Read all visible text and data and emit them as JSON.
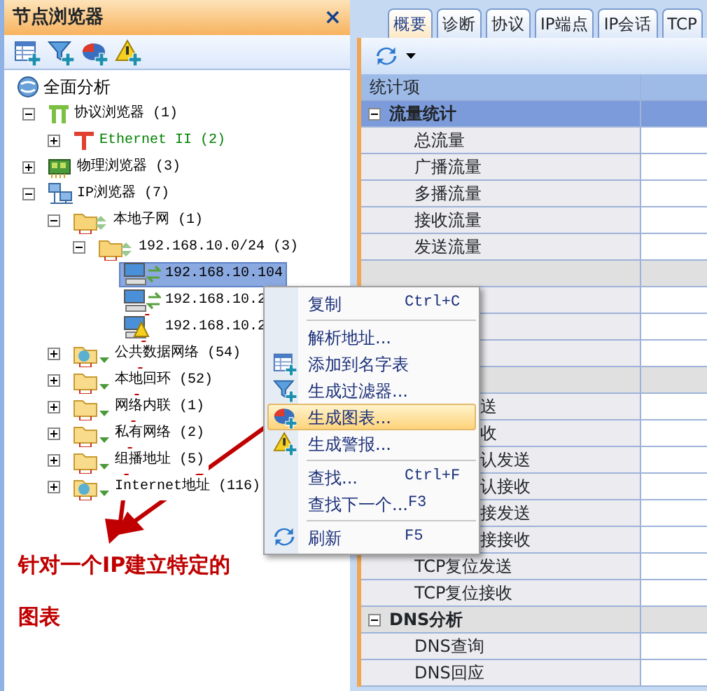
{
  "left_panel": {
    "title": "节点浏览器",
    "close": "×",
    "tree": [
      {
        "label": "全面分析",
        "kind": "analysis",
        "color": "#000000",
        "selected": false,
        "children": [
          {
            "label": "协议浏览器 (1)",
            "kind": "protocol",
            "color": "#000000",
            "selected": false,
            "expanded": true,
            "children": [
              {
                "label": "Ethernet II (2)",
                "kind": "ethernet",
                "color": "#008000",
                "selected": false,
                "expanded": false
              }
            ]
          },
          {
            "label": "物理浏览器 (3)",
            "kind": "physical",
            "color": "#000000",
            "selected": false,
            "expanded": false
          },
          {
            "label": "IP浏览器 (7)",
            "kind": "ip",
            "color": "#000000",
            "selected": false,
            "expanded": true,
            "children": [
              {
                "label": "本地子网 (1)",
                "kind": "subnet",
                "color": "#000000",
                "selected": false,
                "expanded": true,
                "children": [
                  {
                    "label": "192.168.10.0/24 (3)",
                    "kind": "subnet",
                    "color": "#000000",
                    "selected": false,
                    "expanded": true,
                    "children": [
                      {
                        "label": "192.168.10.104",
                        "kind": "host",
                        "color": "#000000",
                        "selected": true
                      },
                      {
                        "label": "192.168.10.2",
                        "kind": "host",
                        "color": "#000000",
                        "selected": false
                      },
                      {
                        "label": "192.168.10.2",
                        "kind": "warning",
                        "color": "#000000",
                        "selected": false
                      }
                    ]
                  }
                ]
              },
              {
                "label": "公共数据网络 (54)",
                "kind": "globe",
                "color": "#000000",
                "selected": false,
                "expanded": false
              },
              {
                "label": "本地回环 (52)",
                "kind": "folder",
                "color": "#000000",
                "selected": false,
                "expanded": false
              },
              {
                "label": "网络内联 (1)",
                "kind": "folder",
                "color": "#000000",
                "selected": false,
                "expanded": false
              },
              {
                "label": "私有网络 (2)",
                "kind": "folder",
                "color": "#000000",
                "selected": false,
                "expanded": false
              },
              {
                "label": "组播地址 (5)",
                "kind": "folder",
                "color": "#000000",
                "selected": false,
                "expanded": false
              },
              {
                "label": "Internet地址 (116)",
                "kind": "globe",
                "color": "#000000",
                "selected": false,
                "expanded": false
              }
            ]
          }
        ]
      }
    ],
    "annotation": "针对一个IP建立特定的图表"
  },
  "right_panel": {
    "tabs": [
      {
        "label": "概要",
        "selected": true
      },
      {
        "label": "诊断",
        "selected": false
      },
      {
        "label": "协议",
        "selected": false
      },
      {
        "label": "IP端点",
        "selected": false
      },
      {
        "label": "IP会话",
        "selected": false
      },
      {
        "label": "TCP",
        "selected": false
      }
    ],
    "table": {
      "columns": [
        "统计项"
      ],
      "rows": [
        {
          "kind": "group",
          "label": "流量统计",
          "expanded": true,
          "selected": true
        },
        {
          "kind": "item",
          "label": "总流量"
        },
        {
          "kind": "item",
          "label": "广播流量"
        },
        {
          "kind": "item",
          "label": "多播流量"
        },
        {
          "kind": "item",
          "label": "接收流量"
        },
        {
          "kind": "item",
          "label": "发送流量"
        },
        {
          "kind": "group",
          "selected": false
        },
        {
          "kind": "item"
        },
        {
          "kind": "item"
        },
        {
          "kind": "item"
        },
        {
          "kind": "group",
          "selected": false
        },
        {
          "kind": "partial",
          "label": "送"
        },
        {
          "kind": "partial",
          "label": "收"
        },
        {
          "kind": "partial",
          "label": "认发送"
        },
        {
          "kind": "partial",
          "label": "认接收"
        },
        {
          "kind": "partial",
          "label": "接发送"
        },
        {
          "kind": "partial",
          "label": "接接收"
        },
        {
          "kind": "item",
          "label": "TCP复位发送"
        },
        {
          "kind": "item",
          "label": "TCP复位接收"
        },
        {
          "kind": "group",
          "label": "DNS分析",
          "expanded": true,
          "selected": false
        },
        {
          "kind": "item",
          "label": "DNS查询"
        },
        {
          "kind": "item",
          "label": "DNS回应"
        }
      ]
    }
  },
  "context_menu": [
    {
      "kind": "item",
      "label": "复制",
      "shortcut": "Ctrl+C",
      "selected": false
    },
    {
      "kind": "separator"
    },
    {
      "kind": "item",
      "label": "解析地址...",
      "selected": false
    },
    {
      "kind": "item",
      "label": "添加到名字表",
      "selected": false
    },
    {
      "kind": "item",
      "label": "生成过滤器...",
      "selected": false
    },
    {
      "kind": "item",
      "label": "生成图表...",
      "selected": true
    },
    {
      "kind": "item",
      "label": "生成警报...",
      "selected": false
    },
    {
      "kind": "separator"
    },
    {
      "kind": "item",
      "label": "查找...",
      "shortcut": "Ctrl+F",
      "selected": false
    },
    {
      "kind": "item",
      "label": "查找下一个...",
      "shortcut": "F3",
      "selected": false
    },
    {
      "kind": "separator"
    },
    {
      "kind": "item",
      "label": "刷新",
      "shortcut": "F5",
      "selected": false
    }
  ]
}
